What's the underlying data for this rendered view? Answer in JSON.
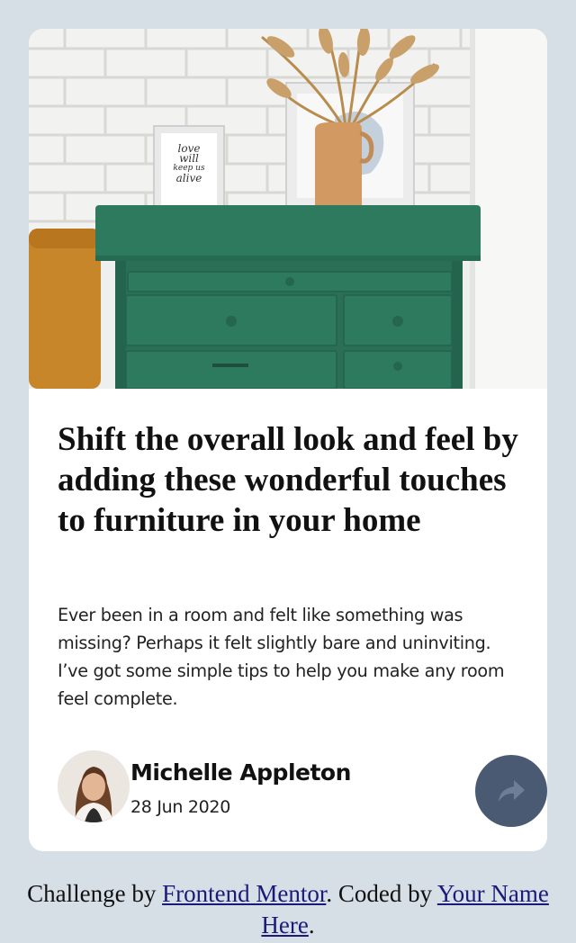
{
  "card": {
    "image": {
      "alt": "Green drawers with a vase and framed art on top",
      "frame_text": [
        "love",
        "will",
        "keep us",
        "alive"
      ]
    },
    "title": "Shift the overall look and feel by adding these wonderful touches to furniture in your home",
    "description": "Ever been in a room and felt like something was missing? Perhaps it felt slightly bare and uninviting. I’ve got some simple tips to help you make any room feel complete.",
    "author": {
      "name": "Michelle Appleton",
      "date": "28 Jun 2020"
    },
    "share_icon": "share-arrow-icon"
  },
  "attribution": {
    "prefix": "Challenge by ",
    "link1": "Frontend Mentor",
    "middle": ". Coded by ",
    "link2": "Your Name Here",
    "suffix": "."
  },
  "colors": {
    "page_bg": "#d6dee6",
    "card_bg": "#ffffff",
    "share_button": "#4a5a73",
    "drawer_green": "#2e7a5f",
    "link": "#1a1a78"
  }
}
